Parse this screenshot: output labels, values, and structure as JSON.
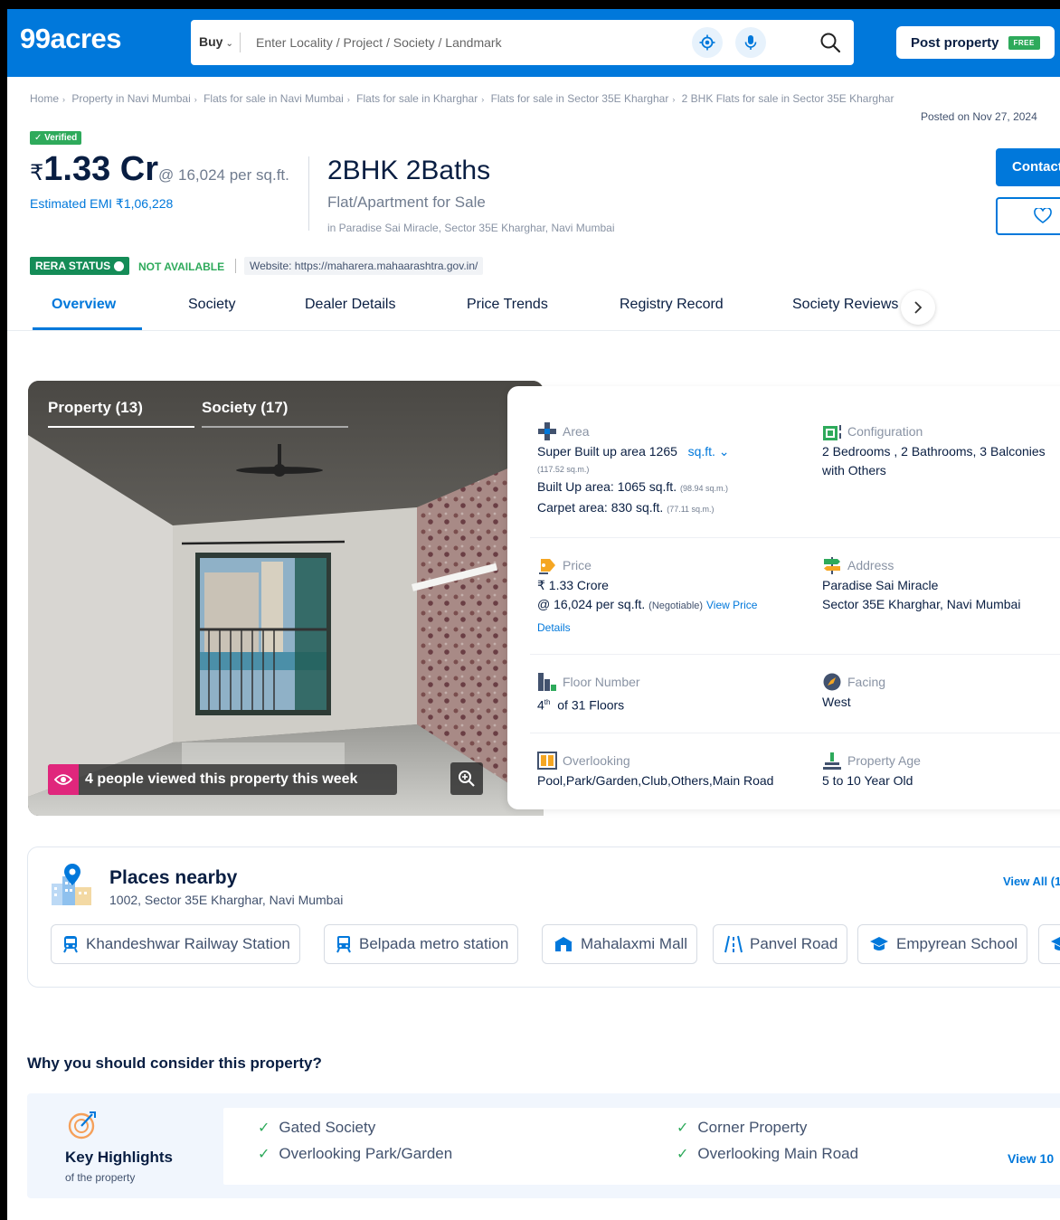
{
  "header": {
    "logo": "99acres",
    "buy_label": "Buy",
    "search_placeholder": "Enter Locality / Project / Society / Landmark",
    "post_property": "Post property",
    "free_tag": "FREE"
  },
  "breadcrumb": [
    "Home",
    "Property in Navi Mumbai",
    "Flats for sale in Navi Mumbai",
    "Flats for sale in Kharghar",
    "Flats for sale in Sector 35E Kharghar",
    "2 BHK Flats for sale in Sector 35E Kharghar"
  ],
  "posted": "Posted on Nov 27, 2024",
  "listing": {
    "verified": "✓ Verified",
    "currency": "₹",
    "price": "1.33 Cr",
    "price_per_sqft": "@ 16,024 per sq.ft.",
    "emi": "Estimated EMI ₹1,06,228",
    "bhk": "2BHK 2Baths",
    "type": "Flat/Apartment for Sale",
    "location": "in Paradise Sai Miracle, Sector 35E Kharghar, Navi Mumbai",
    "contact": "Contact"
  },
  "rera": {
    "status": "RERA STATUS",
    "value": "NOT AVAILABLE",
    "website": "Website: https://maharera.mahaarashtra.gov.in/"
  },
  "tabs": [
    "Overview",
    "Society",
    "Dealer Details",
    "Price Trends",
    "Registry Record",
    "Society Reviews"
  ],
  "gallery": {
    "tab_property": "Property (13)",
    "tab_society": "Society (17)",
    "views": "4 people viewed this property this week"
  },
  "details": {
    "area": {
      "label": "Area",
      "super": "Super Built up area 1265",
      "unit": "sq.ft.",
      "super_sqm": "(117.52 sq.m.)",
      "built": "Built Up area: 1065 sq.ft.",
      "built_sqm": "(98.94 sq.m.)",
      "carpet": "Carpet area: 830 sq.ft.",
      "carpet_sqm": "(77.11 sq.m.)"
    },
    "config": {
      "label": "Configuration",
      "line1": "2 Bedrooms , 2 Bathrooms, 3 Balconies",
      "line2": "with Others"
    },
    "price": {
      "label": "Price",
      "line1": "₹ 1.33 Crore",
      "line2": "@ 16,024 per sq.ft.",
      "negotiable": "(Negotiable)",
      "view_price": "View Price",
      "details": "Details"
    },
    "address": {
      "label": "Address",
      "line1": "Paradise Sai Miracle",
      "line2": "Sector 35E Kharghar, Navi Mumbai"
    },
    "floor": {
      "label": "Floor Number",
      "sup": "th",
      "num": "4",
      "rest": "of 31 Floors"
    },
    "facing": {
      "label": "Facing",
      "value": "West"
    },
    "overlooking": {
      "label": "Overlooking",
      "value": "Pool,Park/Garden,Club,Others,Main Road"
    },
    "age": {
      "label": "Property Age",
      "value": "5 to 10 Year Old"
    }
  },
  "nearby": {
    "title": "Places nearby",
    "address": "1002, Sector 35E Kharghar, Navi Mumbai",
    "view_all": "View All (1",
    "places": [
      "Khandeshwar Railway Station",
      "Belpada metro station",
      "Mahalaxmi Mall",
      "Panvel Road",
      "Empyrean School"
    ]
  },
  "why": {
    "title": "Why you should consider this property?",
    "kh_title": "Key Highlights",
    "kh_sub": "of the property",
    "items": [
      "Gated Society",
      "Overlooking Park/Garden",
      "Corner Property",
      "Overlooking Main Road"
    ],
    "view": "View 10"
  },
  "colors": {
    "brand": "#0078db",
    "green": "#2eaa5b",
    "pink": "#e0267c"
  }
}
